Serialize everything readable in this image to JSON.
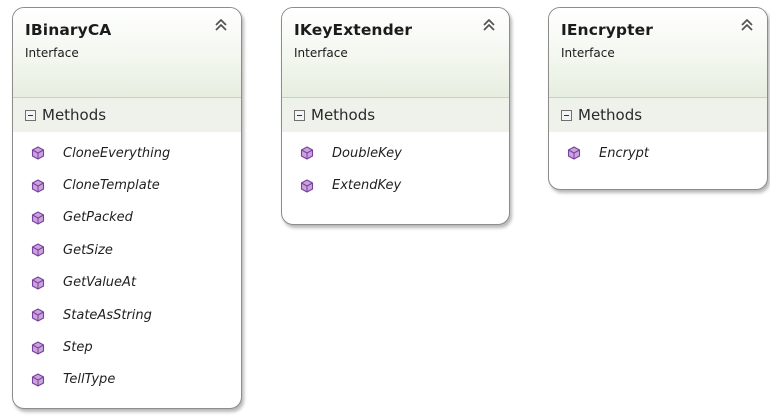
{
  "colors": {
    "header_gradient_end": "#e6eedf",
    "section_band": "#eef2ea",
    "method_icon": "#8b4fb0",
    "border": "#8c8c8c"
  },
  "cards": [
    {
      "title": "IBinaryCA",
      "subtitle": "Interface",
      "collapse_icon": "double-chevron-up-icon",
      "section": "Methods",
      "methods": [
        "CloneEverything",
        "CloneTemplate",
        "GetPacked",
        "GetSize",
        "GetValueAt",
        "StateAsString",
        "Step",
        "TellType"
      ]
    },
    {
      "title": "IKeyExtender",
      "subtitle": "Interface",
      "collapse_icon": "double-chevron-up-icon",
      "section": "Methods",
      "methods": [
        "DoubleKey",
        "ExtendKey"
      ]
    },
    {
      "title": "IEncrypter",
      "subtitle": "Interface",
      "collapse_icon": "double-chevron-up-icon",
      "section": "Methods",
      "methods": [
        "Encrypt"
      ]
    }
  ]
}
